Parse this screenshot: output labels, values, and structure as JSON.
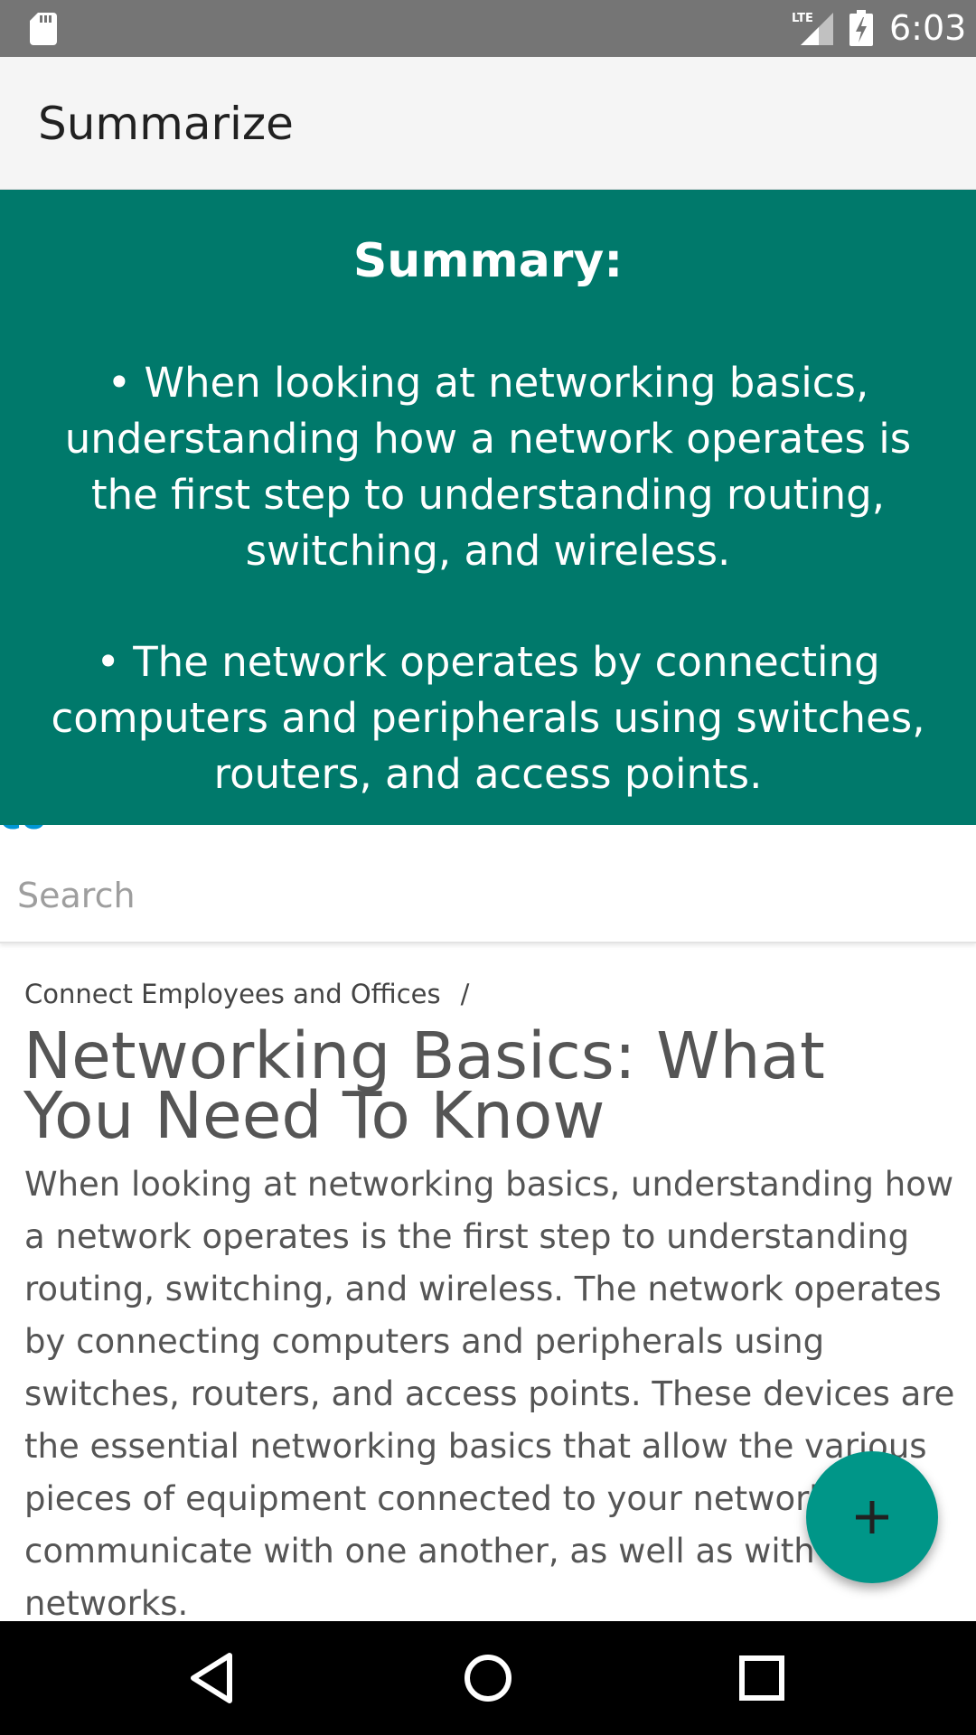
{
  "status_bar": {
    "time": "6:03",
    "network_label": "LTE",
    "icons": [
      "sd-card-icon",
      "lte-signal-icon",
      "battery-charging-icon"
    ]
  },
  "app_bar": {
    "title": "Summarize"
  },
  "summary": {
    "heading": "Summary:",
    "bullets": [
      "• When looking at networking basics, understanding how a network operates is the first step to understanding routing, switching, and wireless.",
      "• The network operates by connecting computers and peripherals using switches, routers, and access points."
    ]
  },
  "webpage": {
    "logo_fragment": "co",
    "search": {
      "placeholder": "Search",
      "value": ""
    },
    "breadcrumb": {
      "item": "Connect Employees and Offices",
      "separator": "/"
    },
    "title": "Networking Basics: What You Need To Know",
    "body": "When looking at networking basics, understanding how a network operates is the first step to understanding routing, switching, and wireless. The network operates by connecting computers and peripherals using switches, routers, and access points. These devices are the essential networking basics that allow the various pieces of equipment connected to your network to communicate with one another, as well as with other networks."
  },
  "fab": {
    "icon": "plus-icon"
  },
  "nav_bar": {
    "icons": [
      "back-icon",
      "home-icon",
      "recents-icon"
    ]
  },
  "colors": {
    "status_bar": "#757575",
    "app_bar": "#f5f5f5",
    "summary_background": "#00796b",
    "fab": "#009688",
    "nav_bar": "#000000",
    "logo_blue": "#0096d6"
  }
}
